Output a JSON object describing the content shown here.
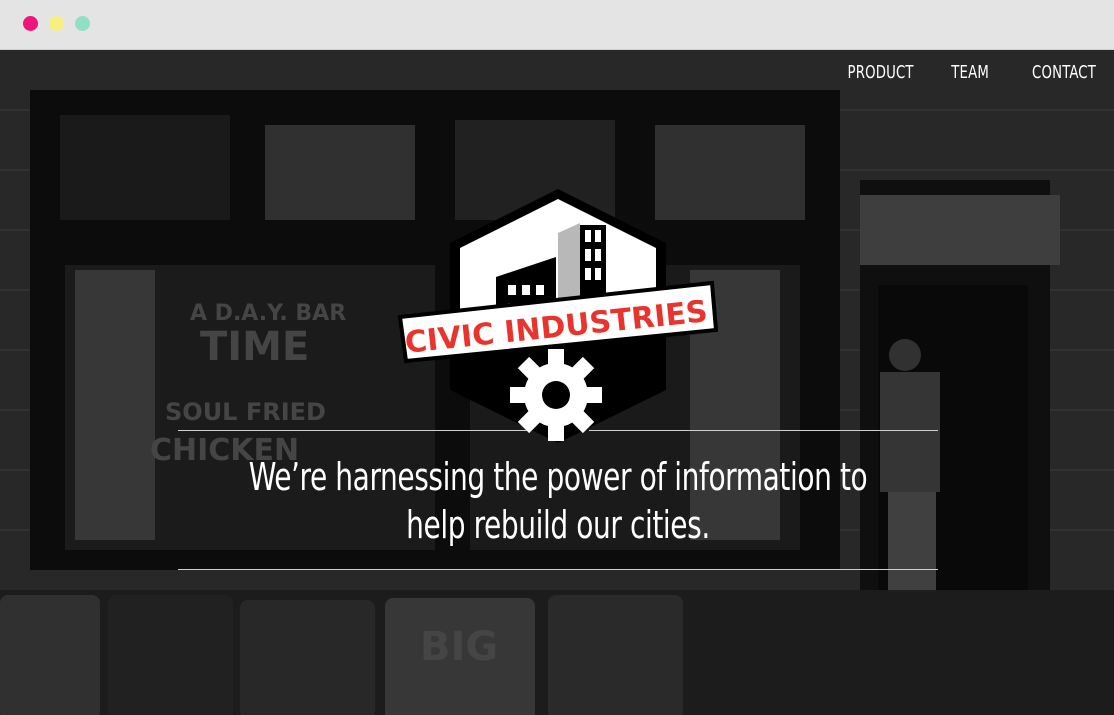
{
  "window": {
    "controls": [
      "close",
      "minimize",
      "zoom"
    ],
    "colors": {
      "close": "#f0147d",
      "minimize": "#f7ef7e",
      "zoom": "#8fe0c4"
    }
  },
  "nav": {
    "items": [
      {
        "label": "PRODUCT"
      },
      {
        "label": "TEAM"
      },
      {
        "label": "CONTACT"
      }
    ]
  },
  "logo": {
    "text": "CIVIC INDUSTRIES",
    "colors": {
      "banner_text": "#e8342c",
      "badge": "#000000",
      "outline": "#ffffff"
    }
  },
  "hero": {
    "headline": "We’re harnessing the power of information to help rebuild our cities.",
    "background": "grayscale storefront photo with painted window signs"
  },
  "theme": {
    "text": "#ffffff",
    "rule": "#cfcfcf"
  }
}
